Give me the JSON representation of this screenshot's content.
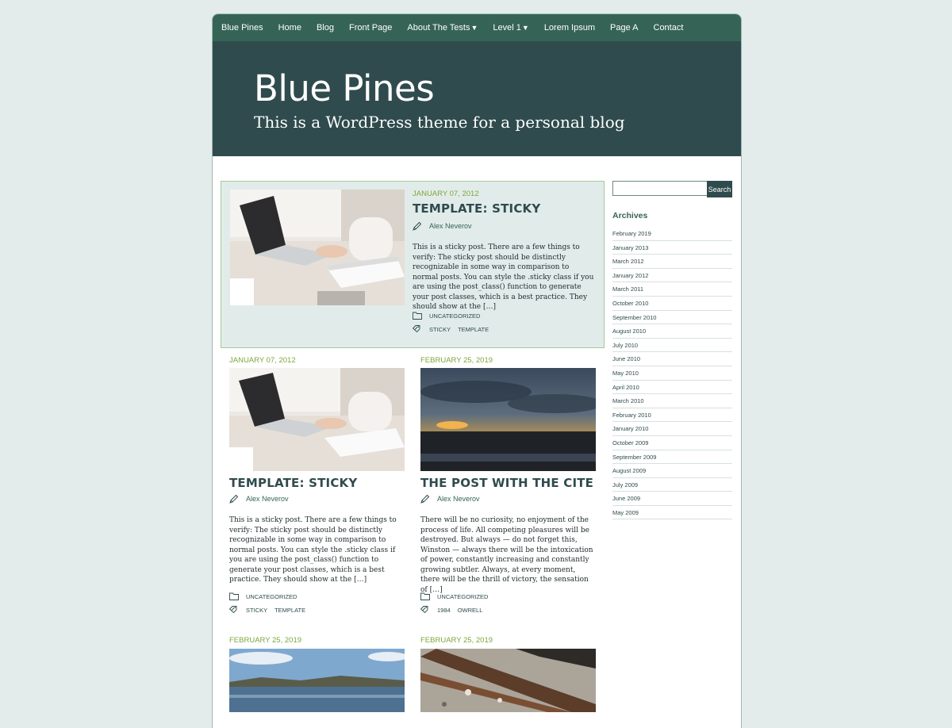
{
  "nav": {
    "items": [
      {
        "label": "Blue Pines"
      },
      {
        "label": "Home"
      },
      {
        "label": "Blog"
      },
      {
        "label": "Front Page"
      },
      {
        "label": "About The Tests",
        "caret": "▼"
      },
      {
        "label": "Level 1",
        "caret": "▼"
      },
      {
        "label": "Lorem Ipsum"
      },
      {
        "label": "Page A"
      },
      {
        "label": "Contact"
      }
    ]
  },
  "header": {
    "title": "Blue Pines",
    "description": "This is a WordPress theme for a personal blog"
  },
  "sticky_post": {
    "date": "JANUARY 07, 2012",
    "title": "TEMPLATE: STICKY",
    "author": "Alex Neverov",
    "excerpt": "This is a sticky post. There are a few things to verify: The sticky post should be distinctly recognizable in some way in comparison to normal posts. You can style the .sticky class if you are using the post_class() function to generate your post classes, which is a best practice. They should show at the […]",
    "category": "UNCATEGORIZED",
    "tags": [
      "STICKY",
      "TEMPLATE"
    ]
  },
  "posts": [
    {
      "date": "JANUARY 07, 2012",
      "title": "TEMPLATE: STICKY",
      "author": "Alex Neverov",
      "excerpt": "This is a sticky post. There are a few things to verify: The sticky post should be distinctly recognizable in some way in comparison to normal posts. You can style the .sticky class if you are using the post_class() function to generate your post classes, which is a best practice. They should show at the […]",
      "category": "UNCATEGORIZED",
      "tags": [
        "STICKY",
        "TEMPLATE"
      ]
    },
    {
      "date": "FEBRUARY 25, 2019",
      "title": "THE POST WITH THE CITE",
      "author": "Alex Neverov",
      "excerpt": "There will be no curiosity, no enjoyment of the process of life. All competing pleasures will be destroyed. But always — do not forget this, Winston — always there will be the intoxication of power, constantly increasing and constantly growing subtler. Always, at every moment, there will be the thrill of victory, the sensation of […]",
      "category": "UNCATEGORIZED",
      "tags": [
        "1984",
        "OWRELL"
      ]
    },
    {
      "date": "FEBRUARY 25, 2019"
    },
    {
      "date": "FEBRUARY 25, 2019"
    }
  ],
  "sidebar": {
    "search_button": "Search",
    "search_placeholder": "",
    "archives_title": "Archives",
    "archives": [
      "February 2019",
      "January 2013",
      "March 2012",
      "January 2012",
      "March 2011",
      "October 2010",
      "September 2010",
      "August 2010",
      "July 2010",
      "June 2010",
      "May 2010",
      "April 2010",
      "March 2010",
      "February 2010",
      "January 2010",
      "October 2009",
      "September 2009",
      "August 2009",
      "July 2009",
      "June 2009",
      "May 2009"
    ]
  },
  "colors": {
    "nav_bg": "#356456",
    "header_bg": "#2f4b4d",
    "date_green": "#7ea63c",
    "page_bg": "#e3eceb"
  }
}
